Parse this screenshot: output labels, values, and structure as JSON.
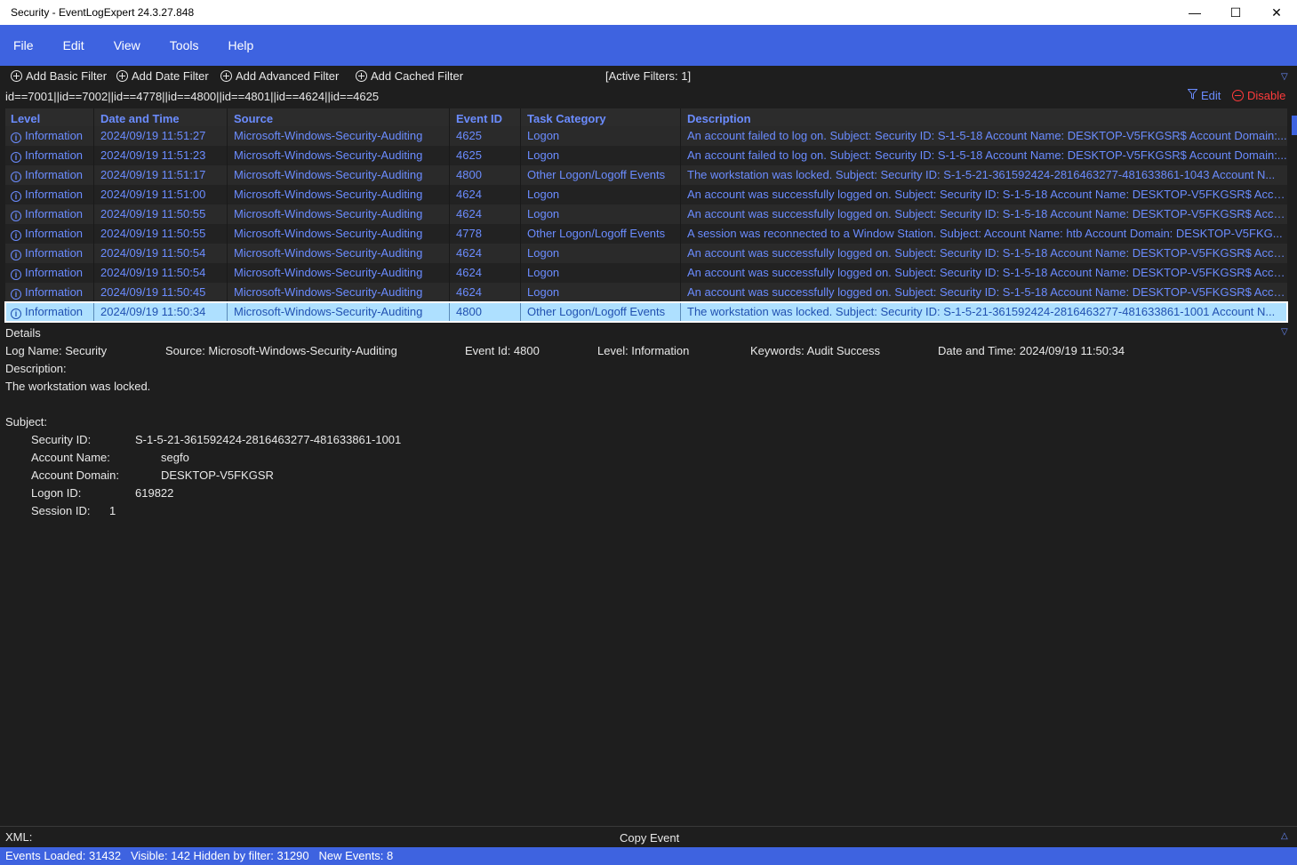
{
  "window": {
    "title": "Security - EventLogExpert 24.3.27.848",
    "minimize": "—",
    "maximize": "☐",
    "close": "✕"
  },
  "menu": [
    "File",
    "Edit",
    "View",
    "Tools",
    "Help"
  ],
  "filterbar": {
    "add_basic": "Add Basic Filter",
    "add_date": "Add Date Filter",
    "add_advanced": "Add Advanced Filter",
    "add_cached": "Add Cached Filter",
    "active_filters": "[Active Filters: 1]",
    "expression": "id==7001||id==7002||id==4778||id==4800||id==4801||id==4624||id==4625",
    "edit": "Edit",
    "disable": "Disable"
  },
  "table": {
    "columns": [
      "Level",
      "Date and Time",
      "Source",
      "Event ID",
      "Task Category",
      "Description"
    ],
    "rows": [
      {
        "level": "Information",
        "date": "2024/09/19 11:51:27",
        "source": "Microsoft-Windows-Security-Auditing",
        "event_id": "4625",
        "task": "Logon",
        "desc": "An account failed to log on. Subject: Security ID: S-1-5-18 Account Name: DESKTOP-V5FKGSR$ Account Domain:..."
      },
      {
        "level": "Information",
        "date": "2024/09/19 11:51:23",
        "source": "Microsoft-Windows-Security-Auditing",
        "event_id": "4625",
        "task": "Logon",
        "desc": "An account failed to log on. Subject: Security ID: S-1-5-18 Account Name: DESKTOP-V5FKGSR$ Account Domain:..."
      },
      {
        "level": "Information",
        "date": "2024/09/19 11:51:17",
        "source": "Microsoft-Windows-Security-Auditing",
        "event_id": "4800",
        "task": "Other Logon/Logoff Events",
        "desc": "The workstation was locked. Subject: Security ID: S-1-5-21-361592424-2816463277-481633861-1043 Account N..."
      },
      {
        "level": "Information",
        "date": "2024/09/19 11:51:00",
        "source": "Microsoft-Windows-Security-Auditing",
        "event_id": "4624",
        "task": "Logon",
        "desc": "An account was successfully logged on. Subject: Security ID: S-1-5-18 Account Name: DESKTOP-V5FKGSR$ Acco..."
      },
      {
        "level": "Information",
        "date": "2024/09/19 11:50:55",
        "source": "Microsoft-Windows-Security-Auditing",
        "event_id": "4624",
        "task": "Logon",
        "desc": "An account was successfully logged on. Subject: Security ID: S-1-5-18 Account Name: DESKTOP-V5FKGSR$ Acco..."
      },
      {
        "level": "Information",
        "date": "2024/09/19 11:50:55",
        "source": "Microsoft-Windows-Security-Auditing",
        "event_id": "4778",
        "task": "Other Logon/Logoff Events",
        "desc": "A session was reconnected to a Window Station. Subject: Account Name: htb Account Domain: DESKTOP-V5FKG..."
      },
      {
        "level": "Information",
        "date": "2024/09/19 11:50:54",
        "source": "Microsoft-Windows-Security-Auditing",
        "event_id": "4624",
        "task": "Logon",
        "desc": "An account was successfully logged on. Subject: Security ID: S-1-5-18 Account Name: DESKTOP-V5FKGSR$ Acco..."
      },
      {
        "level": "Information",
        "date": "2024/09/19 11:50:54",
        "source": "Microsoft-Windows-Security-Auditing",
        "event_id": "4624",
        "task": "Logon",
        "desc": "An account was successfully logged on. Subject: Security ID: S-1-5-18 Account Name: DESKTOP-V5FKGSR$ Acco..."
      },
      {
        "level": "Information",
        "date": "2024/09/19 11:50:45",
        "source": "Microsoft-Windows-Security-Auditing",
        "event_id": "4624",
        "task": "Logon",
        "desc": "An account was successfully logged on. Subject: Security ID: S-1-5-18 Account Name: DESKTOP-V5FKGSR$ Acco..."
      },
      {
        "level": "Information",
        "date": "2024/09/19 11:50:34",
        "source": "Microsoft-Windows-Security-Auditing",
        "event_id": "4800",
        "task": "Other Logon/Logoff Events",
        "desc": "The workstation was locked. Subject: Security ID: S-1-5-21-361592424-2816463277-481633861-1001 Account N..."
      }
    ],
    "selected_index": 9
  },
  "details": {
    "label": "Details",
    "log_name": "Log Name: Security",
    "source": "Source: Microsoft-Windows-Security-Auditing",
    "event_id": "Event Id: 4800",
    "level": "Level: Information",
    "keywords": "Keywords: Audit Success",
    "datetime": "Date and Time: 2024/09/19 11:50:34",
    "description_label": "Description:",
    "description_text": "The workstation was locked.",
    "subject_label": "Subject:",
    "fields": [
      {
        "key": "Security ID:",
        "value": "S-1-5-21-361592424-2816463277-481633861-1001"
      },
      {
        "key": "Account Name:",
        "value": "segfo"
      },
      {
        "key": "Account Domain:",
        "value": "DESKTOP-V5FKGSR"
      },
      {
        "key": "Logon ID:",
        "value": "619822"
      },
      {
        "key": "Session ID:",
        "value": "1"
      }
    ]
  },
  "xml": {
    "label": "XML:",
    "copy": "Copy Event"
  },
  "status": {
    "text": "Events Loaded: 31432   Visible: 142 Hidden by filter: 31290   New Events: 8"
  },
  "colors": {
    "accent": "#3e63e0",
    "link": "#6b8cff",
    "danger": "#ff3b3b",
    "selected_row": "#aee0ff",
    "background": "#1e1e1e"
  }
}
